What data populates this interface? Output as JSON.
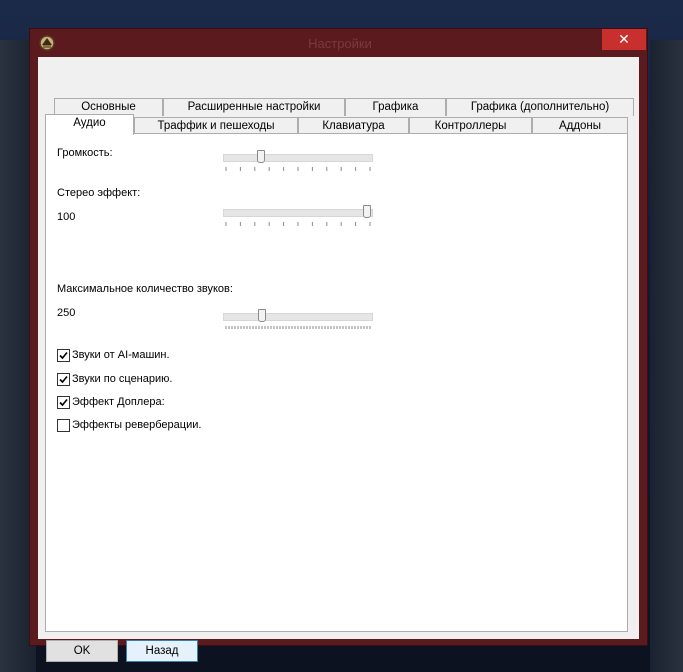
{
  "window": {
    "title": "Настройки",
    "close_glyph": "✕"
  },
  "tabs_row1": [
    "Основные",
    "Расширенные настройки",
    "Графика",
    "Графика (дополнительно)"
  ],
  "tabs_row2": [
    "Аудио",
    "Траффик и пешеходы",
    "Клавиатура",
    "Контроллеры",
    "Аддоны"
  ],
  "active_tab": "Аудио",
  "audio": {
    "volume_label": "Громкость:",
    "volume_level": 0.24,
    "stereo_label": "Стерео эффект:",
    "stereo_value": "100",
    "stereo_level": 1.0,
    "max_sounds_label": "Максимальное количество звуков:",
    "max_sounds_value": "250",
    "max_sounds_level": 0.25
  },
  "checkboxes": [
    {
      "label": "Звуки от AI-машин.",
      "checked": true
    },
    {
      "label": "Звуки по сценарию.",
      "checked": true
    },
    {
      "label": "Эффект Доплера:",
      "checked": true
    },
    {
      "label": "Эффекты реверберации.",
      "checked": false
    }
  ],
  "buttons": {
    "ok": "OK",
    "back": "Назад"
  },
  "colors": {
    "frame": "#5a1a1e",
    "close": "#c7302d",
    "client": "#f0f0f0"
  }
}
